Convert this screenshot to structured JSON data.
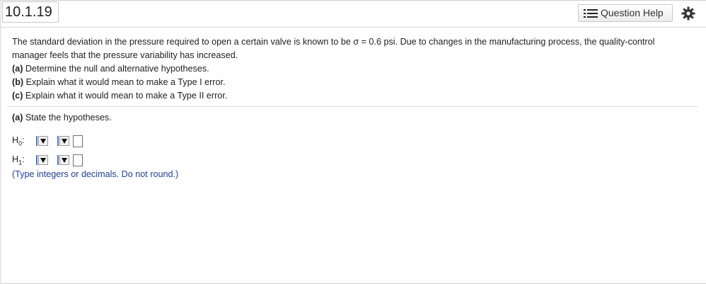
{
  "header": {
    "question_number": "10.1.19",
    "help_label": "Question Help"
  },
  "question": {
    "line1": "The standard deviation in the pressure required to open a certain valve is known to be σ = 0.6 psi. Due to changes in the manufacturing process, the quality-control",
    "line2": "manager feels that the pressure variability has increased.",
    "part_a_tag": "(a)",
    "part_a_text": " Determine the null and alternative hypotheses.",
    "part_b_tag": "(b)",
    "part_b_text": " Explain what it would mean to make a Type I error.",
    "part_c_tag": "(c)",
    "part_c_text": " Explain what it would mean to make a Type II error."
  },
  "answer": {
    "state_tag": "(a)",
    "state_text": " State the hypotheses.",
    "h0_base": "H",
    "h0_sub": "0",
    "h1_base": "H",
    "h1_sub": "1",
    "colon": ":",
    "note": "(Type integers or decimals. Do not round.)"
  },
  "colors": {
    "accent": "#4a78c2",
    "note_text": "#1f3f9a"
  },
  "icons": [
    "list-icon",
    "gear-icon",
    "dropdown-arrow-icon"
  ]
}
